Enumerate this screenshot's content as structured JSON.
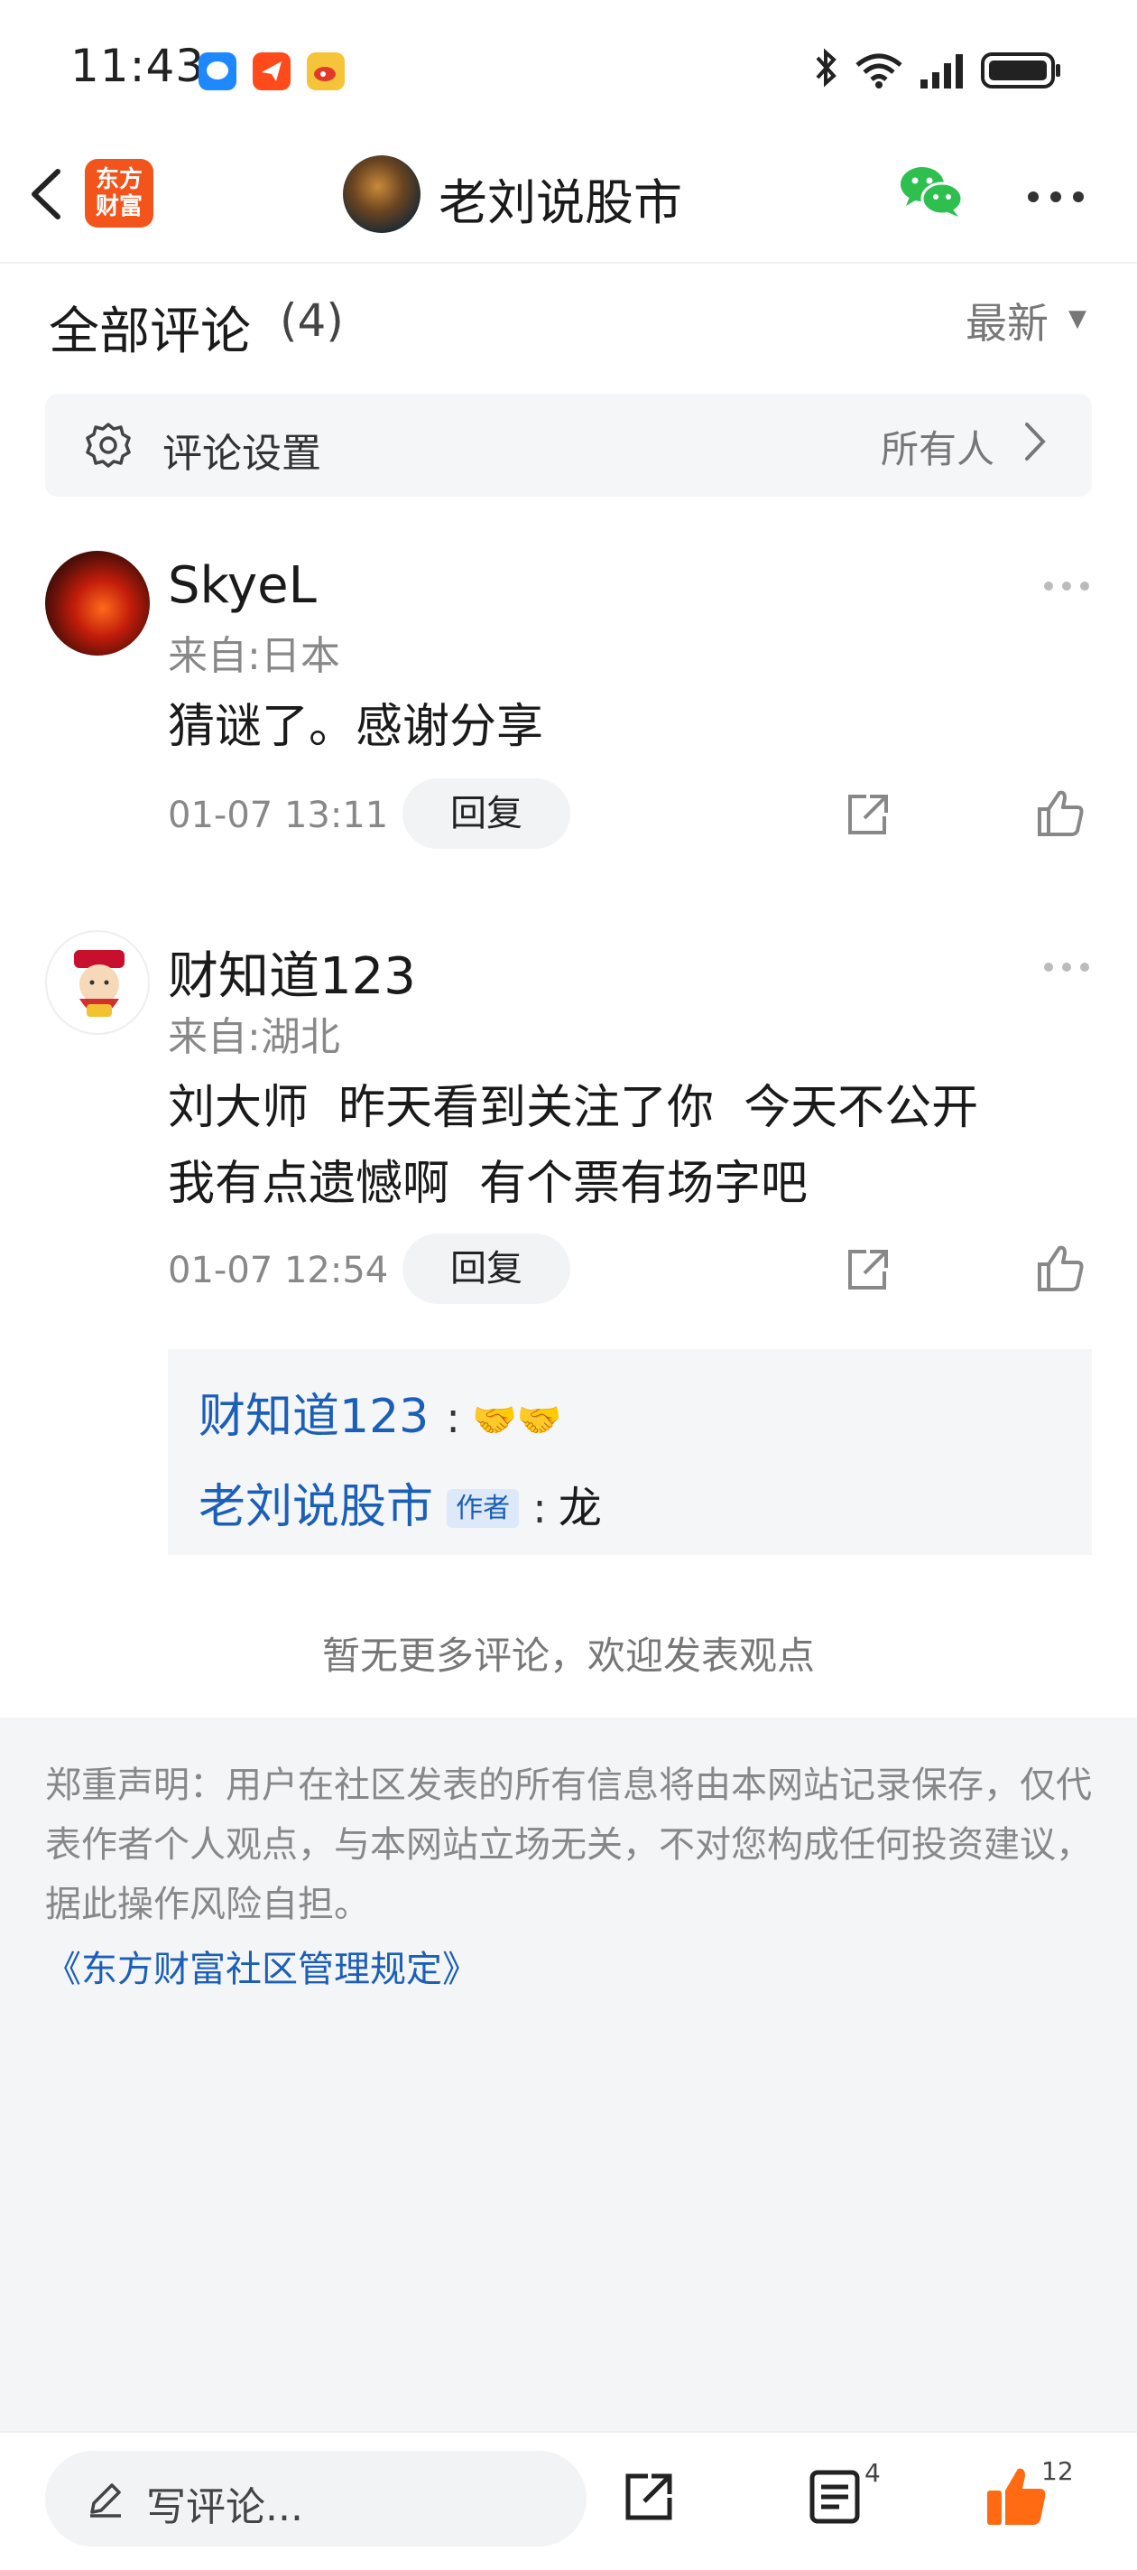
{
  "status_bar": {
    "time": "11:43"
  },
  "nav": {
    "logo_text": "东方\n财富",
    "title": "老刘说股市"
  },
  "comments_header": {
    "title": "全部评论",
    "count": "(4)",
    "sort_label": "最新"
  },
  "settings": {
    "label": "评论设置",
    "value": "所有人"
  },
  "comments": [
    {
      "user": "SkyeL",
      "location": "来自:日本",
      "text_lines": [
        "猜谜了。感谢分享"
      ],
      "time": "01-07 13:11",
      "reply_label": "回复"
    },
    {
      "user": "财知道123",
      "location": "来自:湖北",
      "text_lines": [
        "刘大师  昨天看到关注了你  今天不公开",
        "我有点遗憾啊  有个票有场字吧"
      ],
      "time": "01-07 12:54",
      "reply_label": "回复"
    }
  ],
  "thread_replies": [
    {
      "user": "财知道123",
      "colon": ":",
      "text": "🤝🤝"
    },
    {
      "user": "老刘说股市",
      "badge": "作者",
      "colon": ":",
      "text": "龙"
    }
  ],
  "no_more": "暂无更多评论，欢迎发表观点",
  "disclaimer": "郑重声明：用户在社区发表的所有信息将由本网站记录保存，仅代表作者个人观点，与本网站立场无关，不对您构成任何投资建议，据此操作风险自担。",
  "rules_link": "《东方财富社区管理规定》",
  "bottom_bar": {
    "write_placeholder": "写评论...",
    "comments_badge": "4",
    "likes_badge": "12"
  },
  "colors": {
    "brand": "#f2541c",
    "link": "#1b5fb8",
    "like": "#ff6a13"
  }
}
